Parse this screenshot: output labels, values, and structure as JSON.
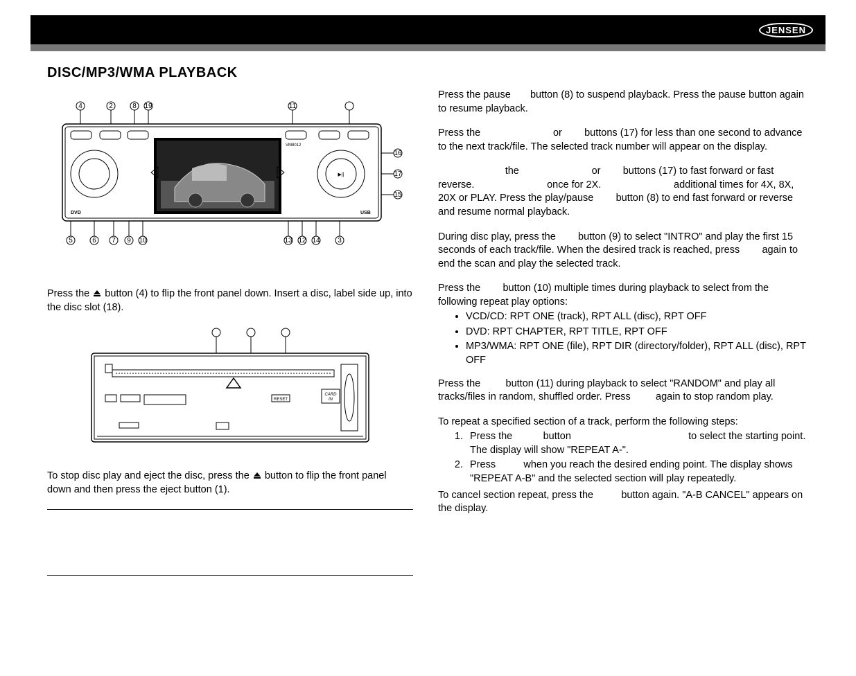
{
  "brand": "JENSEN",
  "title": "DISC/MP3/WMA PLAYBACK",
  "callouts_top": [
    "4",
    "2",
    "8",
    "19",
    "11",
    "16",
    "17",
    "15",
    "5",
    "6",
    "7",
    "9",
    "10",
    "13",
    "12",
    "14",
    "3"
  ],
  "facepanel_labels": {
    "model": "VM8012",
    "dvd": "DVD",
    "usb": "USB"
  },
  "slot_labels": {
    "card": "CARD IN",
    "reset": "RESET"
  },
  "left": {
    "p1a": "Press the ",
    "p1b": " button (4) to flip the front panel down. Insert a disc, label side up, into the disc slot (18).",
    "p2a": "To stop disc play and eject the disc, press the ",
    "p2b": " button to flip the front panel down and then press the eject button (1)."
  },
  "right": {
    "pause": "Press the pause       button (8) to suspend playback. Press the pause button again to resume playback.",
    "track": "Press the                          or        buttons (17) for less than one second to advance to the next track/file. The selected track number will appear on the display.",
    "ff": "                        the                          or        buttons (17) to fast forward or fast reverse.                          once for 2X.                          additional times for 4X, 8X, 20X or PLAY. Press the play/pause        button (8) to end fast forward or reverse and resume normal playback.",
    "intro": "During disc play, press the        button (9) to select \"INTRO\" and play the first 15 seconds of each track/file. When the desired track is reached, press        again to end the scan and play the selected track.",
    "rpt_intro": "Press the        button (10) multiple times during playback to select from the following repeat play options:",
    "rpt_items": [
      "VCD/CD: RPT ONE (track), RPT ALL (disc), RPT OFF",
      "DVD: RPT CHAPTER, RPT TITLE, RPT OFF",
      "MP3/WMA: RPT ONE (file), RPT DIR (directory/folder), RPT ALL (disc), RPT OFF"
    ],
    "random": "Press the         button (11) during playback to select \"RANDOM\" and play all tracks/files in random, shuffled order. Press         again to stop random play.",
    "ab_intro": "To repeat a specified section of a track, perform the following steps:",
    "ab_steps": [
      "Press the           button                                          to select the starting point. The display will show \"REPEAT A-\".",
      "Press          when you reach the desired ending point. The display shows \"REPEAT A-B\" and the selected section will play repeatedly."
    ],
    "ab_cancel": "To cancel section repeat, press the          button again. \"A-B CANCEL\" appears on the display."
  }
}
